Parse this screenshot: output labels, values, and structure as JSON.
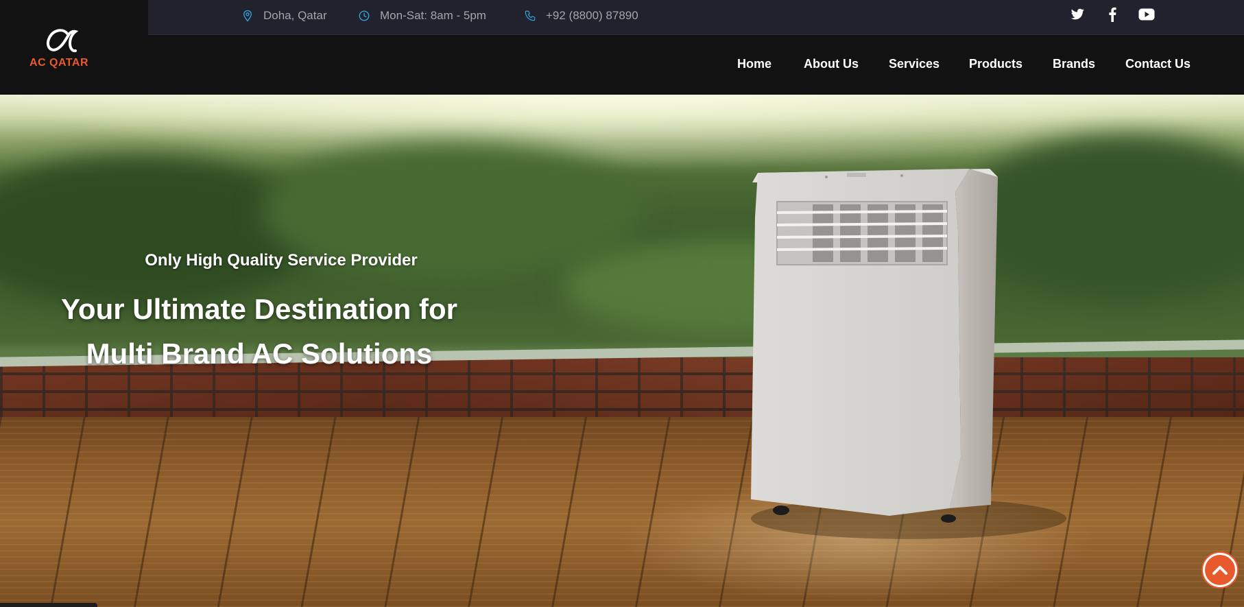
{
  "brand": {
    "name": "AC QATAR",
    "logo_icon": "alpha-symbol-icon",
    "accent_color": "#e85a2b"
  },
  "topbar": {
    "location": "Doha, Qatar",
    "hours": "Mon-Sat: 8am - 5pm",
    "phone": "+92 (8800) 87890",
    "icon_color": "#2aa8d8",
    "social": [
      "twitter-icon",
      "facebook-icon",
      "youtube-icon"
    ]
  },
  "nav": {
    "items": [
      "Home",
      "About Us",
      "Services",
      "Products",
      "Brands",
      "Contact Us"
    ]
  },
  "hero": {
    "subtitle": "Only High Quality Service Provider",
    "title_line1": "Your Ultimate Destination for",
    "title_line2": "Multi Brand AC Solutions"
  },
  "scroll_top": {
    "icon": "chevron-up-icon"
  }
}
